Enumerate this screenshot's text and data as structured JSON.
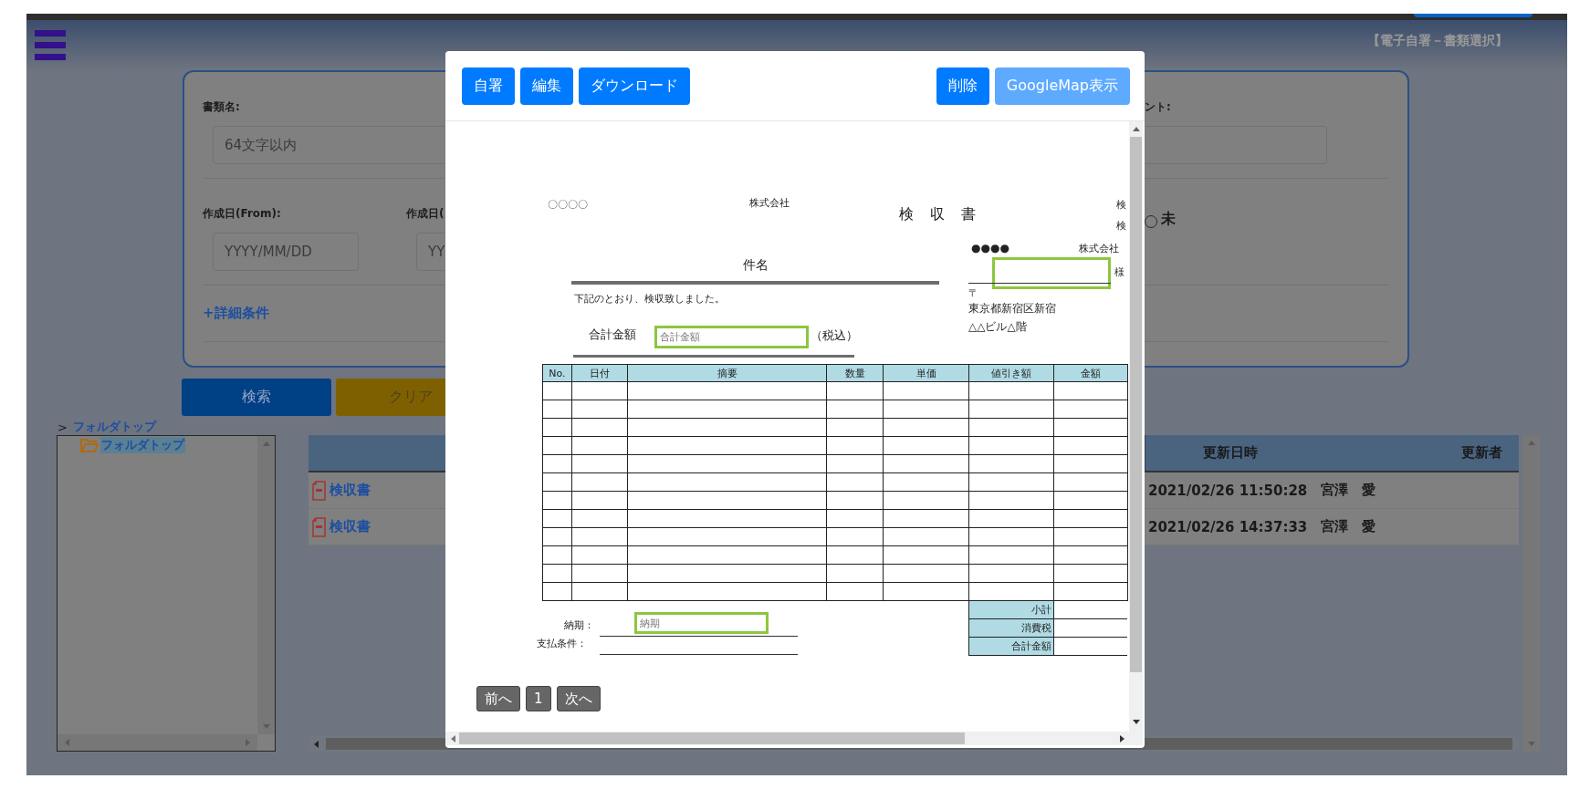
{
  "header": {
    "title": "【電子自署－書類選択】"
  },
  "search": {
    "name_field": {
      "label": "書類名:",
      "placeholder": "64文字以内"
    },
    "comment_field": {
      "label": "ント:"
    },
    "date_fields": [
      {
        "label": "作成日(From):",
        "placeholder": "YYYY/MM/DD"
      },
      {
        "label": "作成日(",
        "placeholder": "YY"
      }
    ],
    "status_radio": {
      "label": "未",
      "selected": false
    },
    "details_link": "+詳細条件"
  },
  "actions": [
    {
      "label": "検索",
      "kind": "search"
    },
    {
      "label": "クリア",
      "kind": "clear"
    }
  ],
  "breadcrumb": {
    "separator": ">",
    "label": "フォルダトップ"
  },
  "folder_tree": [
    {
      "label": "フォルダトップ",
      "selected": true
    }
  ],
  "table": {
    "columns": [
      "更新日時",
      "更新者"
    ],
    "rows": [
      {
        "name": "検収書",
        "updated": "2021/02/26 11:50:28",
        "updater": "宮澤　愛"
      },
      {
        "name": "検収書",
        "updated": "2021/02/26 14:37:33",
        "updater": "宮澤　愛"
      }
    ]
  },
  "modal": {
    "left_buttons": [
      {
        "label": "自署",
        "disabled": false
      },
      {
        "label": "編集",
        "disabled": false
      },
      {
        "label": "ダウンロード",
        "disabled": false
      }
    ],
    "right_buttons": [
      {
        "label": "削除",
        "disabled": false
      },
      {
        "label": "GoogleMap表示",
        "disabled": true
      }
    ],
    "document": {
      "issuer": "〇〇〇〇",
      "issuer_suffix": "株式会社",
      "title": "検　収　書",
      "right_labels": [
        "検",
        "検"
      ],
      "subject": "件名",
      "recipient": "●●●●",
      "recipient_suffix": "株式会社",
      "honorific": "様",
      "postal_mark": "〒",
      "address": [
        "東京都新宿区新宿",
        "△△ビル△階"
      ],
      "statement": "下記のとおり、検収致しました。",
      "total_label": "合計金額",
      "total_placeholder": "合計金額",
      "tax_note": "（税込）",
      "columns": [
        "No.",
        "日付",
        "摘要",
        "数量",
        "単価",
        "値引き額",
        "金額"
      ],
      "summary": [
        "小計",
        "消費税",
        "合計金額"
      ],
      "delivery_label": "納期：",
      "delivery_placeholder": "納期",
      "payment_label": "支払条件："
    },
    "pagination": {
      "prev": "前へ",
      "pages": [
        "1"
      ],
      "next": "次へ"
    }
  }
}
